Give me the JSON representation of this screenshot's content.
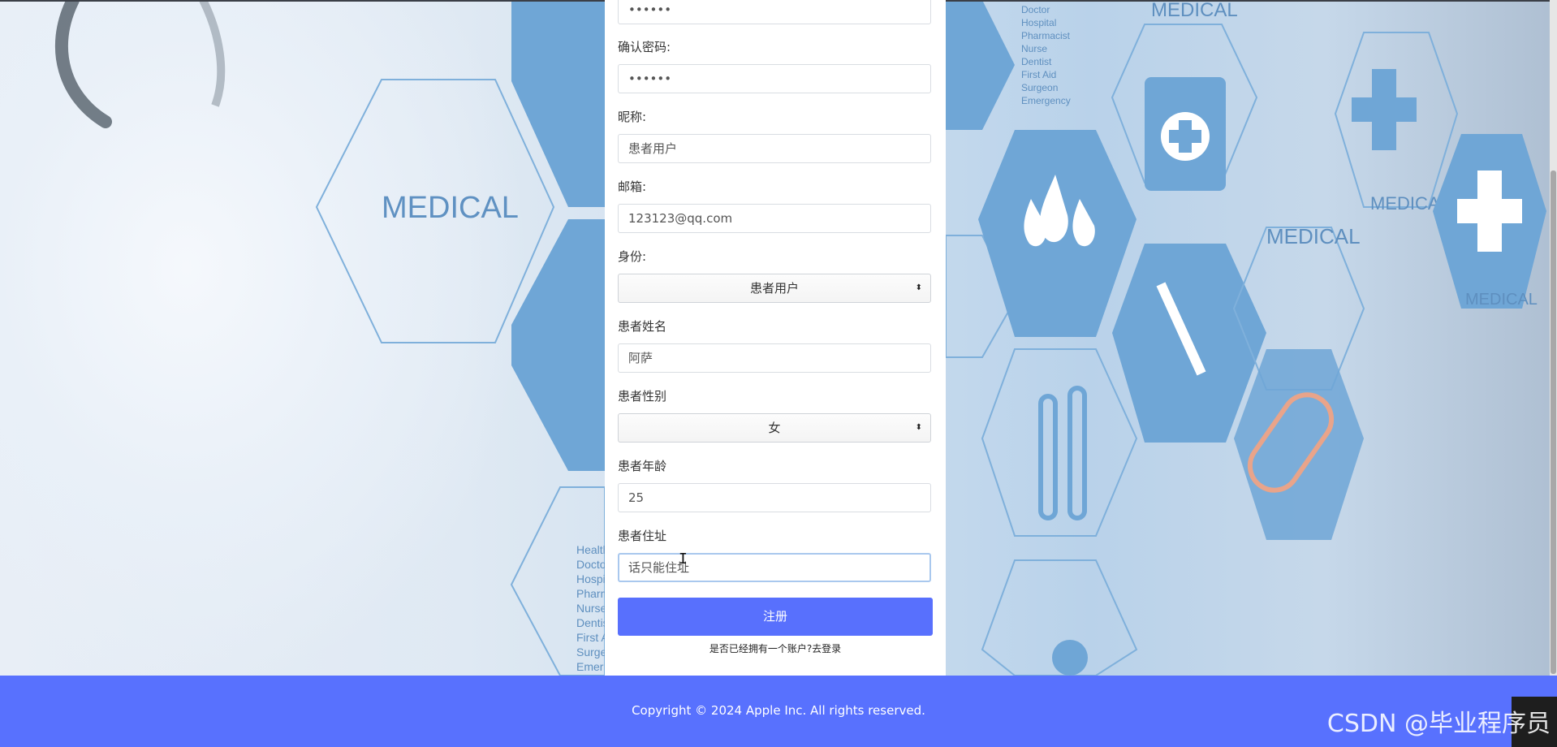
{
  "background": {
    "hex_labels": [
      "MEDICAL",
      "MEDICAL",
      "MEDICAL",
      "MEDICAL",
      "MEDICAL"
    ],
    "staff_list_right": [
      "Doctor",
      "Hospital",
      "Pharmacist",
      "Nurse",
      "Dentist",
      "First Aid",
      "Surgeon",
      "Emergency"
    ],
    "staff_list_left": [
      "Health",
      "Doctor",
      "Hospi",
      "Pharm",
      "Nurse",
      "Dentis",
      "First A",
      "Surge",
      "Emer"
    ]
  },
  "form": {
    "password_value": "••••••",
    "confirm_password_label": "确认密码:",
    "confirm_password_value": "••••••",
    "nickname_label": "昵称:",
    "nickname_value": "患者用户",
    "email_label": "邮箱:",
    "email_value": "123123@qq.com",
    "role_label": "身份:",
    "role_value": "患者用户",
    "patient_name_label": "患者姓名",
    "patient_name_value": "阿萨",
    "patient_gender_label": "患者性别",
    "patient_gender_value": "女",
    "patient_age_label": "患者年龄",
    "patient_age_value": "25",
    "patient_address_label": "患者住址",
    "patient_address_value": "话只能住址",
    "register_button": "注册",
    "login_link": "是否已经拥有一个账户?去登录"
  },
  "footer": {
    "copyright": "Copyright © 2024 Apple Inc. All rights reserved."
  },
  "watermark": "CSDN @毕业程序员",
  "colors": {
    "accent": "#5870fd",
    "footer": "#5871fe",
    "hex_blue": "#6fa6d6"
  }
}
